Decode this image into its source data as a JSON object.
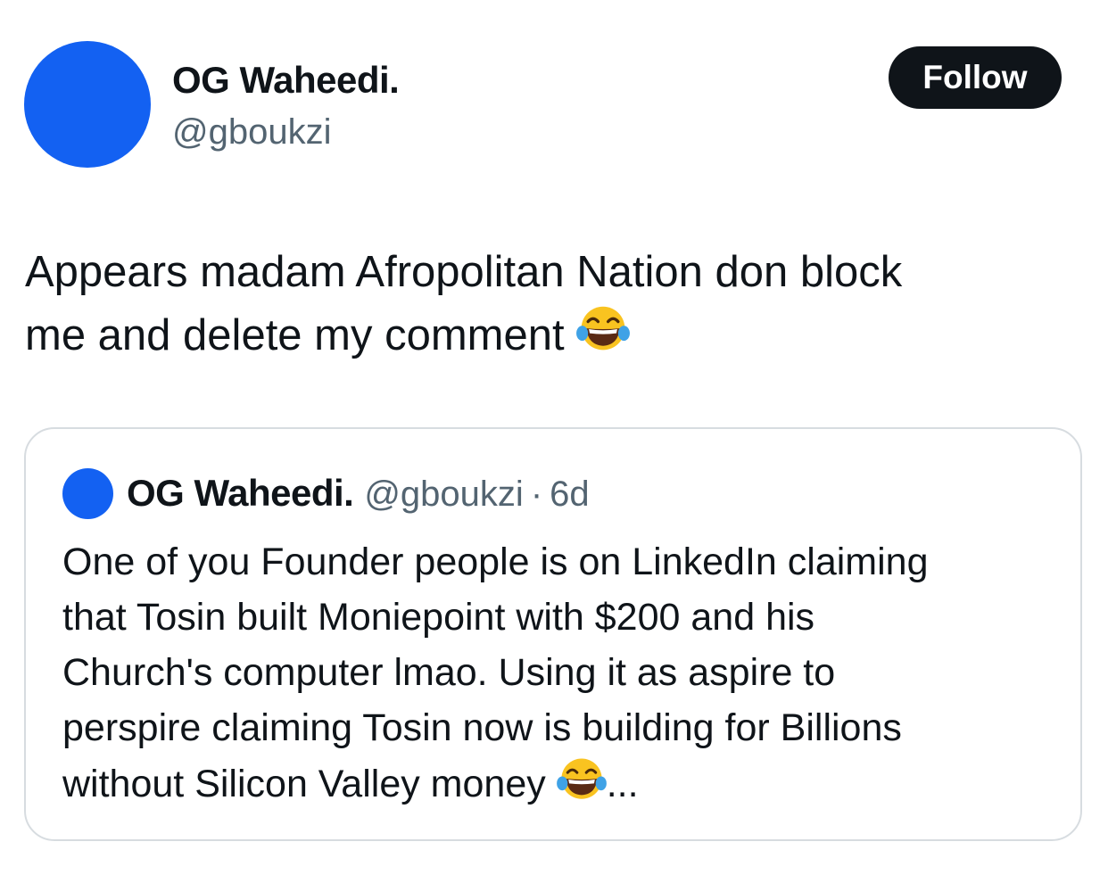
{
  "author": {
    "display_name": "OG Waheedi.",
    "handle": "@gboukzi",
    "avatar_color": "#1361f2"
  },
  "follow_button": {
    "label": "Follow"
  },
  "tweet": {
    "line1": "Appears madam Afropolitan Nation don block",
    "line2": "me and delete my comment",
    "emoji": "face-with-tears-of-joy"
  },
  "quoted_tweet": {
    "display_name": "OG Waheedi.",
    "handle": "@gboukzi",
    "separator": "·",
    "time": "6d",
    "lines": [
      "One of you Founder people is on LinkedIn claiming",
      "that Tosin built Moniepoint with $200 and his",
      "Church's computer lmao. Using it as aspire to",
      "perspire claiming Tosin now is building for Billions",
      "without Silicon Valley money"
    ],
    "truncation": "..."
  }
}
